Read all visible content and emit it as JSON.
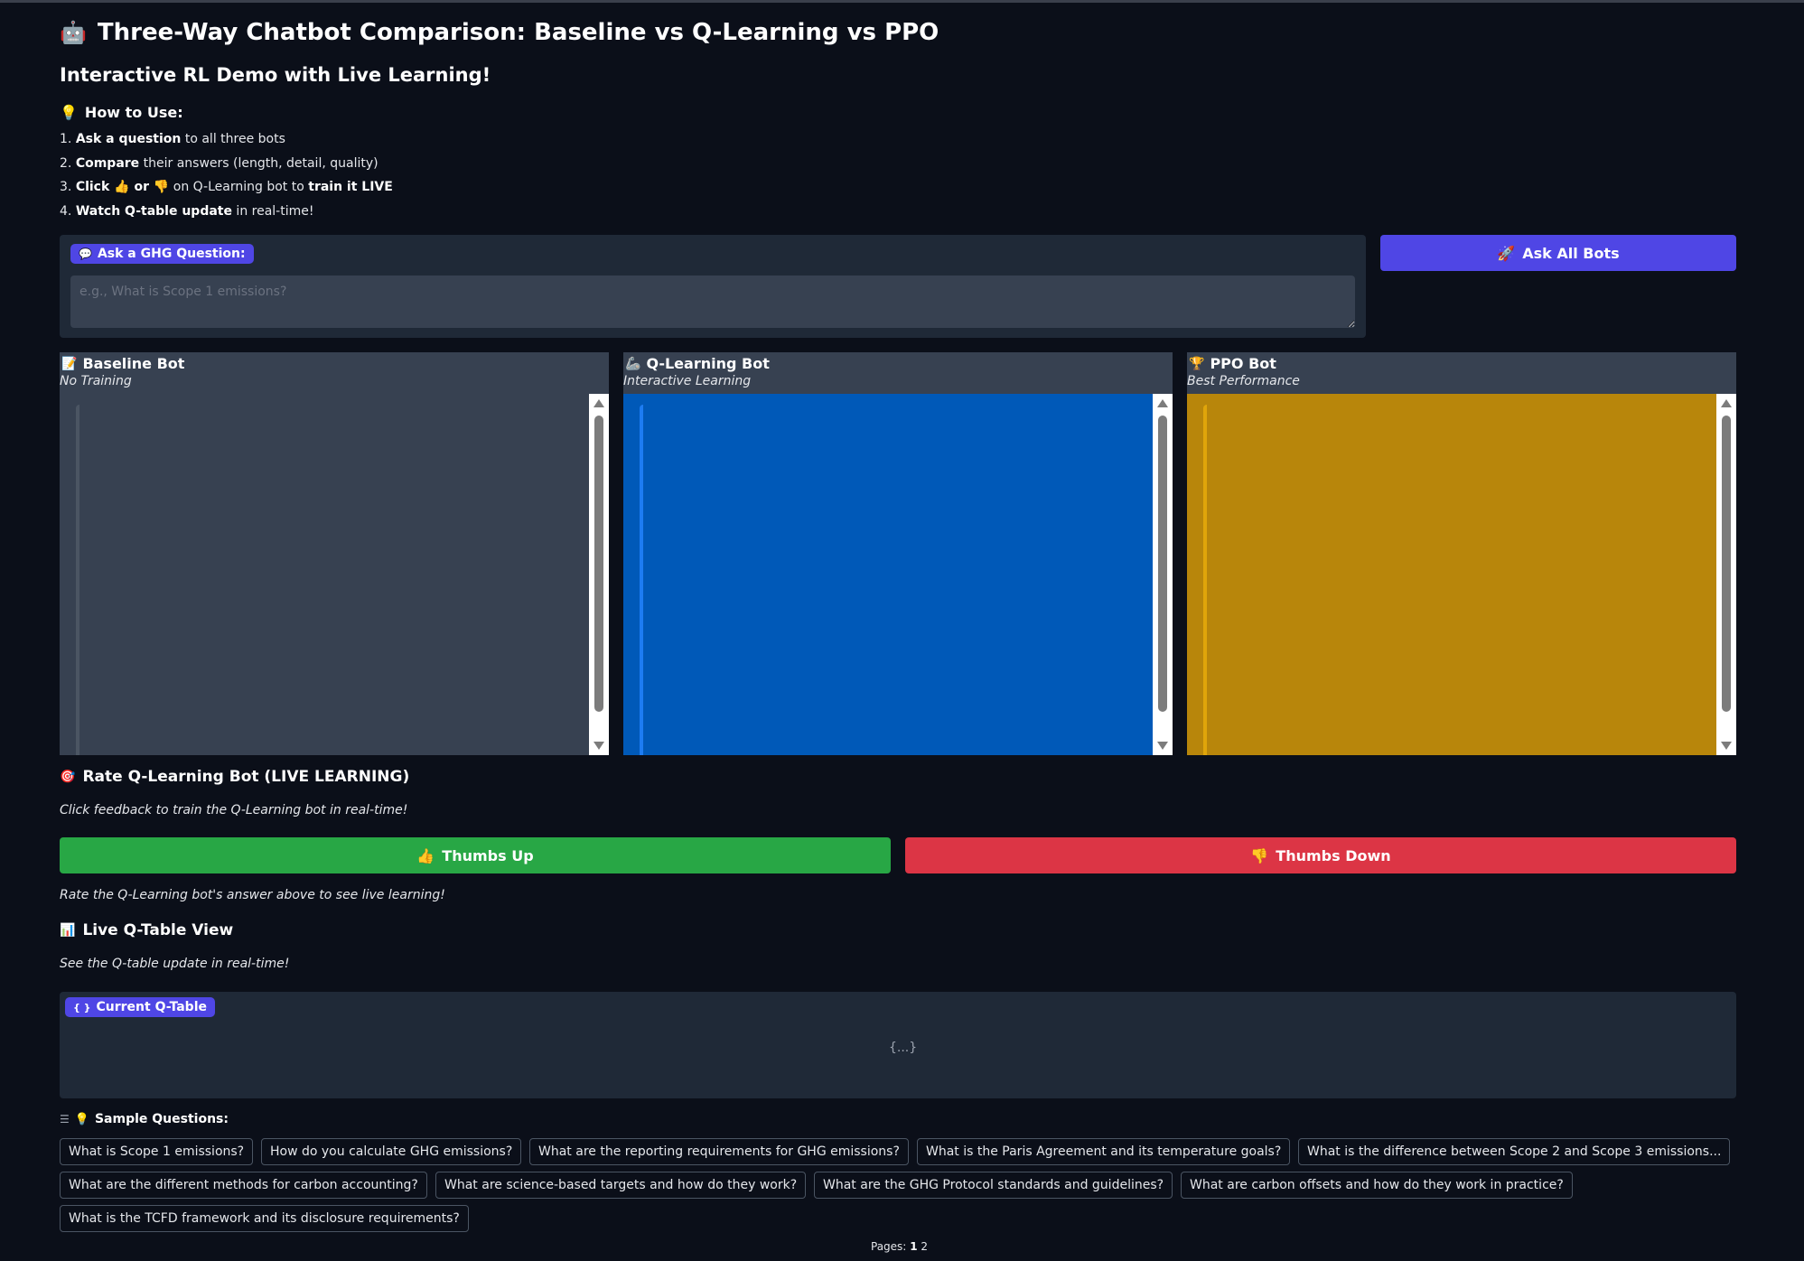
{
  "header": {
    "title": "Three-Way Chatbot Comparison: Baseline vs Q-Learning vs PPO",
    "subtitle": "Interactive RL Demo with Live Learning!"
  },
  "how_to": {
    "heading": "How to Use:",
    "steps": [
      {
        "num": "1.",
        "bold": "Ask a question",
        "rest": " to all three bots"
      },
      {
        "num": "2.",
        "bold": "Compare",
        "rest": " their answers (length, detail, quality)"
      },
      {
        "num": "3.",
        "bold": "Click 👍 or 👎",
        "rest": " on Q-Learning bot to ",
        "bold2": "train it LIVE"
      },
      {
        "num": "4.",
        "bold": "Watch Q-table update",
        "rest": " in real-time!"
      }
    ]
  },
  "ask": {
    "label": "Ask a GHG Question:",
    "placeholder": "e.g., What is Scope 1 emissions?",
    "button_label": "Ask All Bots"
  },
  "bots": [
    {
      "name": "Baseline Bot",
      "subtitle": "No Training",
      "icon": "memo-icon",
      "color": "#374151",
      "bar": "#4b5563"
    },
    {
      "name": "Q-Learning Bot",
      "subtitle": "Interactive Learning",
      "icon": "robot-arm-icon",
      "color": "#0059b8",
      "bar": "#1d7cf2"
    },
    {
      "name": "PPO Bot",
      "subtitle": "Best Performance",
      "icon": "trophy-icon",
      "color": "#b8860b",
      "bar": "#e0a50a"
    }
  ],
  "rating": {
    "heading": "Rate Q-Learning Bot (LIVE LEARNING)",
    "hint": "Click feedback to train the Q-Learning bot in real-time!",
    "thumbs_up": "Thumbs Up",
    "thumbs_down": "Thumbs Down",
    "status": "Rate the Q-Learning bot's answer above to see live learning!",
    "up_color": "#28a745",
    "down_color": "#dc3545"
  },
  "qtable": {
    "heading": "Live Q-Table View",
    "hint": "See the Q-table update in real-time!",
    "label": "Current Q-Table",
    "empty": "{...}"
  },
  "samples": {
    "heading": "Sample Questions:",
    "items": [
      "What is Scope 1 emissions?",
      "How do you calculate GHG emissions?",
      "What are the reporting requirements for GHG emissions?",
      "What is the Paris Agreement and its temperature goals?",
      "What is the difference between Scope 2 and Scope 3 emissions...",
      "What are the different methods for carbon accounting?",
      "What are science-based targets and how do they work?",
      "What are the GHG Protocol standards and guidelines?",
      "What are carbon offsets and how do they work in practice?",
      "What is the TCFD framework and its disclosure requirements?"
    ]
  },
  "pagination": {
    "label": "Pages:",
    "current": "1",
    "other": "2"
  },
  "theme": {
    "background": "#0b0f19",
    "accent": "#4f46e5"
  }
}
